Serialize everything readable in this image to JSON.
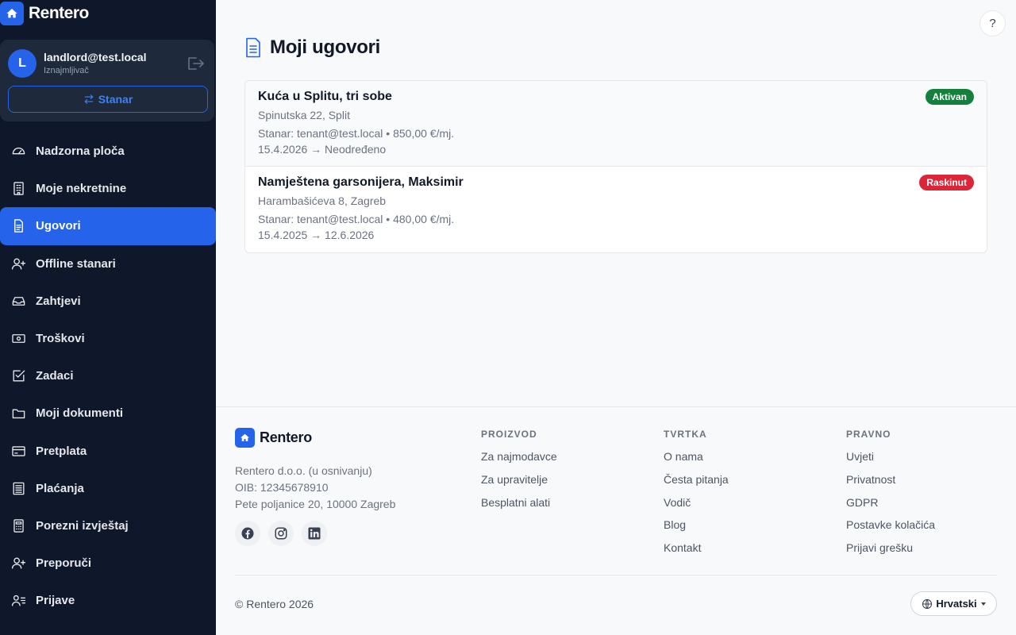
{
  "app": {
    "name": "Rentero"
  },
  "user": {
    "initial": "L",
    "email": "landlord@test.local",
    "role": "Iznajmljivač",
    "switch_label": "Stanar"
  },
  "nav": [
    {
      "label": "Nadzorna ploča",
      "icon": "gauge-icon",
      "active": false
    },
    {
      "label": "Moje nekretnine",
      "icon": "building-icon",
      "active": false
    },
    {
      "label": "Ugovori",
      "icon": "document-icon",
      "active": true
    },
    {
      "label": "Offline stanari",
      "icon": "user-plus-icon",
      "active": false
    },
    {
      "label": "Zahtjevi",
      "icon": "inbox-icon",
      "active": false
    },
    {
      "label": "Troškovi",
      "icon": "cash-icon",
      "active": false
    },
    {
      "label": "Zadaci",
      "icon": "checkbox-icon",
      "active": false
    },
    {
      "label": "Moji dokumenti",
      "icon": "folder-icon",
      "active": false
    },
    {
      "label": "Pretplata",
      "icon": "credit-card-icon",
      "active": false
    },
    {
      "label": "Plaćanja",
      "icon": "receipt-icon",
      "active": false
    },
    {
      "label": "Porezni izvještaj",
      "icon": "calculator-icon",
      "active": false
    },
    {
      "label": "Preporuči",
      "icon": "user-plus-icon",
      "active": false
    },
    {
      "label": "Prijave",
      "icon": "user-list-icon",
      "active": false
    }
  ],
  "page": {
    "title": "Moji ugovori",
    "help": "?"
  },
  "contracts": [
    {
      "title": "Kuća u Splitu, tri sobe",
      "address": "Spinutska 22, Split",
      "meta": "Stanar: tenant@test.local • 850,00 €/mj.",
      "dates": "15.4.2026 → Neodređeno",
      "status": "Aktivan",
      "status_color": "#15803d"
    },
    {
      "title": "Namještena garsonijera, Maksimir",
      "address": "Harambašićeva 8, Zagreb",
      "meta": "Stanar: tenant@test.local • 480,00 €/mj.",
      "dates": "15.4.2025 → 12.6.2026",
      "status": "Raskinut",
      "status_color": "#dc2638"
    }
  ],
  "footer": {
    "brand": "Rentero",
    "company_lines": [
      "Rentero d.o.o. (u osnivanju)",
      "OIB: 12345678910",
      "Pete poljanice 20, 10000 Zagreb"
    ],
    "socials": [
      "facebook-icon",
      "instagram-icon",
      "linkedin-icon"
    ],
    "columns": [
      {
        "title": "PROIZVOD",
        "links": [
          "Za najmodavce",
          "Za upravitelje",
          "Besplatni alati"
        ]
      },
      {
        "title": "TVRTKA",
        "links": [
          "O nama",
          "Česta pitanja",
          "Vodič",
          "Blog",
          "Kontakt"
        ]
      },
      {
        "title": "PRAVNO",
        "links": [
          "Uvjeti",
          "Privatnost",
          "GDPR",
          "Postavke kolačića",
          "Prijavi grešku"
        ]
      }
    ],
    "copyright": "© Rentero 2026",
    "language": "Hrvatski"
  },
  "colors": {
    "accent": "#2563eb",
    "sidebar_bg": "#0f172a",
    "active_badge": "#15803d",
    "terminated_badge": "#dc2638"
  }
}
